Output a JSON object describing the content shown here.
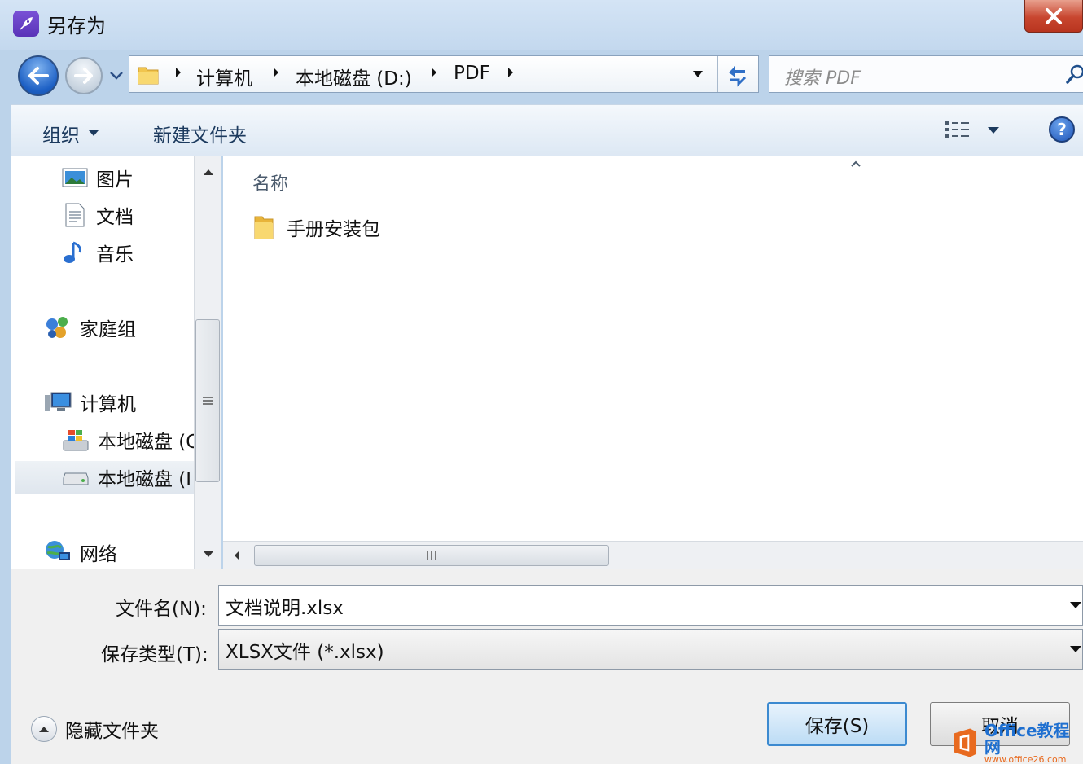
{
  "window": {
    "title": "另存为",
    "close_label": "X"
  },
  "navigation": {
    "breadcrumb": [
      "计算机",
      "本地磁盘 (D:)",
      "PDF"
    ],
    "search_placeholder": "搜索 PDF"
  },
  "toolbar": {
    "organize_label": "组织",
    "new_folder_label": "新建文件夹"
  },
  "nav_pane": {
    "libraries": [
      {
        "label": "图片",
        "icon": "pictures-icon"
      },
      {
        "label": "文档",
        "icon": "documents-icon"
      },
      {
        "label": "音乐",
        "icon": "music-icon"
      }
    ],
    "homegroup": "家庭组",
    "computer": "计算机",
    "drives": [
      {
        "label": "本地磁盘 (C",
        "icon": "system-drive-icon"
      },
      {
        "label": "本地磁盘 (I",
        "icon": "drive-icon",
        "selected": true
      }
    ],
    "network": "网络"
  },
  "file_list": {
    "column_name": "名称",
    "items": [
      {
        "name": "手册安装包",
        "type": "folder"
      }
    ]
  },
  "form": {
    "filename_label": "文件名(N):",
    "filename_value": "文档说明.xlsx",
    "filetype_label": "保存类型(T):",
    "filetype_value": "XLSX文件 (*.xlsx)",
    "hide_folders_label": "隐藏文件夹",
    "save_label": "保存(S)",
    "cancel_label": "取消"
  },
  "watermark": {
    "main": "Office教程网",
    "sub": "www.office26.com"
  },
  "colors": {
    "accent": "#3c8ad0",
    "close": "#c8462f",
    "watermark_blue": "#1e6fd0",
    "watermark_orange": "#e86a1f"
  }
}
